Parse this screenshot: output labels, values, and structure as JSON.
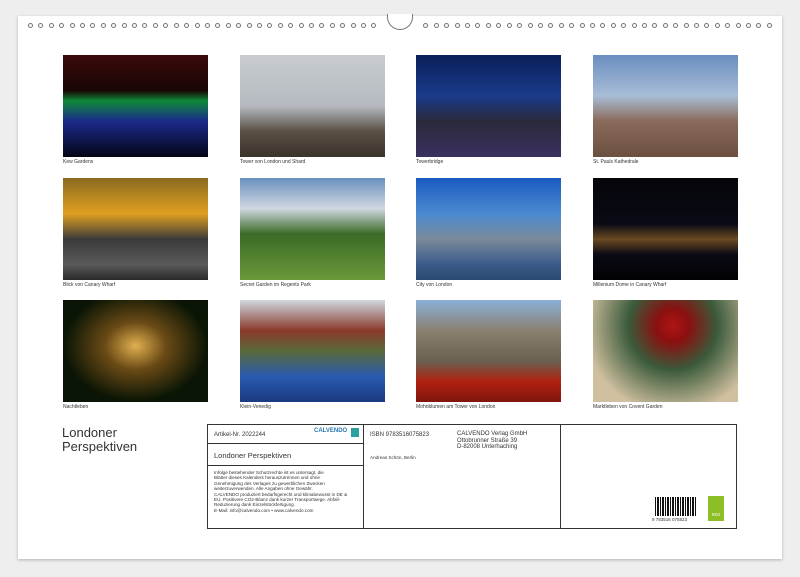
{
  "photos": [
    {
      "caption": "Kew Gardens",
      "bg": "linear-gradient(#3a0a0a 0%,#1a0505 35%,#0e8a3a 45%,#1b2a8a 65%,#050515 100%)"
    },
    {
      "caption": "Tower von London und Shard",
      "bg": "linear-gradient(#c8ccd0 0%,#b5bac0 50%,#5a5045 75%,#3a332b 100%)"
    },
    {
      "caption": "Towerbridge",
      "bg": "linear-gradient(#0a1f5a 0%,#1a3a8a 40%,#2a2a3a 65%,#3a3060 100%)"
    },
    {
      "caption": "St. Pauls Kathedrale",
      "bg": "linear-gradient(#6a8ec0 0%,#a8bdd6 40%,#8a6a5a 65%,#6a5040 100%)"
    },
    {
      "caption": "Blick von Canary Wharf",
      "bg": "linear-gradient(#8a6a20 0%,#e0a020 35%,#3a3a3a 60%,#5a5a5a 85%,#2a2a2a 100%)"
    },
    {
      "caption": "Secret Garden im Regents Park",
      "bg": "linear-gradient(#6a90c0 0%,#d0d8e0 30%,#3a6a25 55%,#6a9a3a 100%)"
    },
    {
      "caption": "City von London",
      "bg": "linear-gradient(#1a5ac0 0%,#4a8ad0 35%,#7a8a9a 60%,#3a5a8a 85%,#2a4a70 100%)"
    },
    {
      "caption": "Millenium Dome in Canary Wharf",
      "bg": "linear-gradient(#05050a 0%,#0a0a15 45%,#6a4a20 60%,#0a0a15 75%,#020205 100%)"
    },
    {
      "caption": "Nachtleben",
      "bg": "radial-gradient(ellipse at 50% 45%,#e0b050 0%,#6a4a15 30%,#0a1505 70%)"
    },
    {
      "caption": "Klein-Venedig",
      "bg": "linear-gradient(#d0d8e0 0%,#8a3a2a 30%,#5a6a3a 50%,#2a5ab0 75%,#1a3a80 100%)"
    },
    {
      "caption": "Mohnblumen am Tower von London",
      "bg": "linear-gradient(#8ab0d8 0%,#8a8070 30%,#6a6050 60%,#b02010 80%,#801510 100%)"
    },
    {
      "caption": "Marktleben von Covent Garden",
      "bg": "radial-gradient(circle at 55% 25%,#b01515 0%,#8a1010 15%,#3a5a3a 40%,#d0c0a0 80%)"
    }
  ],
  "title": "Londoner Perspektiven",
  "info": {
    "article": "Artikel-Nr. 2022244",
    "brand": "CALVENDO",
    "product_title": "Londoner Perspektiven",
    "legal": [
      "Infolge bestehender Schutzrechte ist es untersagt, die",
      "Blätter dieses Kalenders herauszutrennen und ohne",
      "Genehmigung des Verlages zu gewerblichen Zwecken",
      "weiterzuverwenden. Alle Angaben ohne Gewähr.",
      "CALVENDO produziert bedarfsgerecht und klimabewusst in DE &",
      "EU. Positivere CO2-Bilanz dank kurzer Transportwege. Abfall-",
      "Reduzierung dank Einzelstückfertigung.",
      "E-Mail: info@calvendo.com • www.calvendo.com"
    ],
    "isbn": "ISBN 9783516075823",
    "author": "Andreas Schön, Berlin",
    "publisher": [
      "CALVENDO Verlag GmbH",
      "Ottobrunner Straße 39",
      "D-82008 Unterhaching"
    ],
    "barcode_number": "9 783516 075823",
    "eco_label": "eco"
  }
}
